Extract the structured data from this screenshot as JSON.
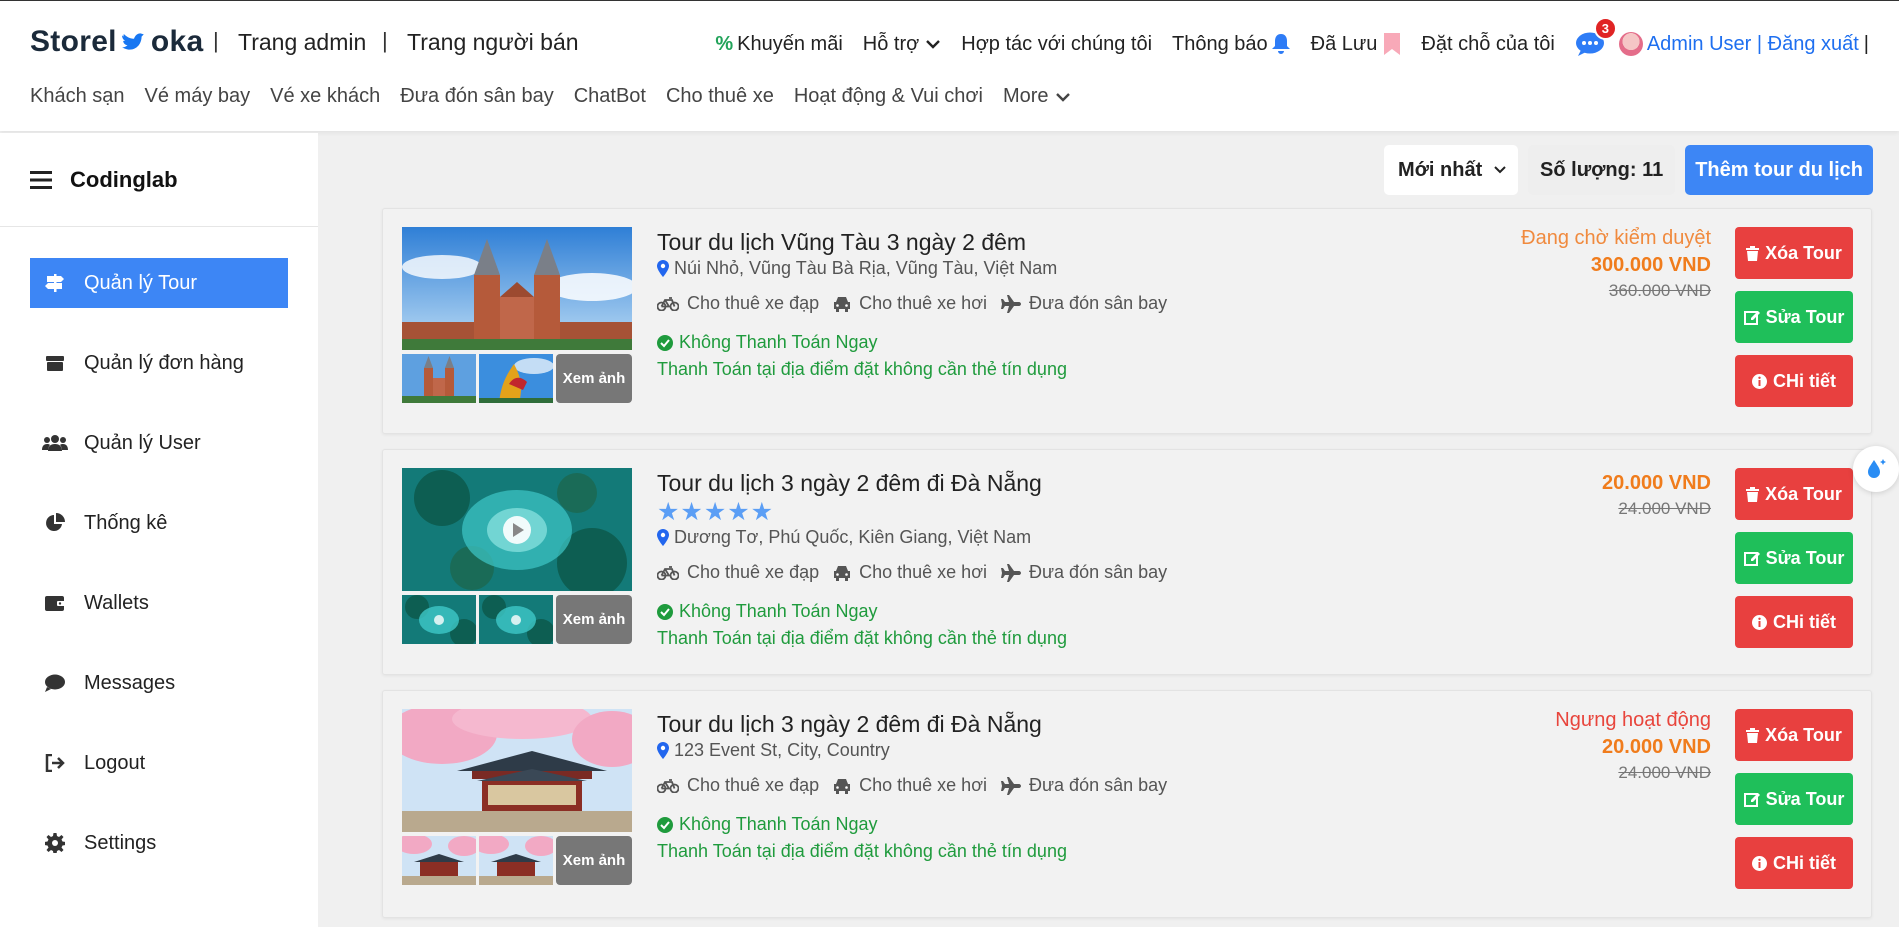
{
  "brand": {
    "logo_text_left": "Storel",
    "logo_text_right": "oka"
  },
  "top_links": {
    "admin": "Trang admin",
    "seller": "Trang người bán",
    "separator": "|"
  },
  "right_menu": {
    "promo": "Khuyến mãi",
    "support": "Hỗ trợ",
    "partner": "Hợp tác với chúng tôi",
    "notifications": "Thông báo",
    "saved": "Đã Lưu",
    "bookings": "Đặt chỗ của tôi",
    "chat_badge": "3",
    "user": "Admin User | Đăng xuất",
    "trailing_sep": "|"
  },
  "sub_nav": [
    "Khách sạn",
    "Vé máy bay",
    "Vé xe khách",
    "Đưa đón sân bay",
    "ChatBot",
    "Cho thuê xe",
    "Hoạt động & Vui chơi",
    "More"
  ],
  "sidebar": {
    "brand": "Codinglab",
    "items": [
      {
        "label": "Quản lý Tour",
        "icon": "signpost-icon"
      },
      {
        "label": "Quản lý đơn hàng",
        "icon": "box-icon"
      },
      {
        "label": "Quản lý User",
        "icon": "users-icon"
      },
      {
        "label": "Thống kê",
        "icon": "pie-chart-icon"
      },
      {
        "label": "Wallets",
        "icon": "wallet-icon"
      },
      {
        "label": "Messages",
        "icon": "message-icon"
      },
      {
        "label": "Logout",
        "icon": "logout-icon"
      },
      {
        "label": "Settings",
        "icon": "gear-icon"
      }
    ]
  },
  "toolbar": {
    "sort_value": "Mới nhất",
    "count_label": "Số lượng: 11",
    "add_label": "Thêm tour du lịch"
  },
  "common": {
    "view_more": "Xem ảnh",
    "feature_bike": "Cho thuê xe đạp",
    "feature_car": "Cho thuê xe hơi",
    "feature_airport": "Đưa đón sân bay",
    "pay_label": "Không Thanh Toán Ngay",
    "pay_note": "Thanh Toán tại địa điểm đặt không cần thẻ tín dụng",
    "delete_label": "Xóa Tour",
    "edit_label": "Sửa Tour",
    "detail_label": "CHi tiết"
  },
  "tours": [
    {
      "title": "Tour du lịch Vũng Tàu 3 ngày 2 đêm",
      "location": "Núi Nhỏ, Vũng Tàu Bà Rịa, Vũng Tàu, Việt Nam",
      "status": "Đang chờ kiểm duyệt",
      "price": "300.000 VND",
      "old_price": "360.000 VND",
      "stars": ""
    },
    {
      "title": "Tour du lịch 3 ngày 2 đêm đi Đà Nẵng",
      "location": "Dương Tơ, Phú Quốc, Kiên Giang, Việt Nam",
      "status": "",
      "price": "20.000 VND",
      "old_price": "24.000 VND",
      "stars": "★★★★★"
    },
    {
      "title": "Tour du lịch 3 ngày 2 đêm đi Đà Nẵng",
      "location": "123 Event St, City, Country",
      "status": "Ngưng hoạt động",
      "price": "20.000 VND",
      "old_price": "24.000 VND",
      "stars": ""
    }
  ],
  "colors": {
    "accent": "#3d86f5",
    "danger": "#e8403f",
    "success": "#1fbf5a",
    "price": "#f07c1c"
  }
}
